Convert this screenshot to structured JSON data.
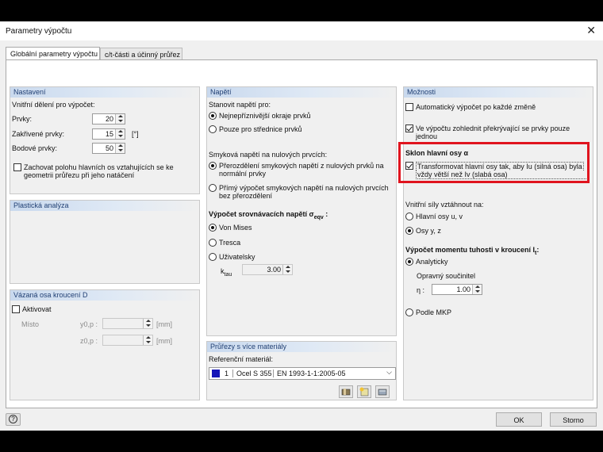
{
  "window": {
    "title": "Parametry výpočtu",
    "close": "✕"
  },
  "tabs": [
    "Globální parametry výpočtu",
    "c/t-části a účinný průřez"
  ],
  "nastaveni": {
    "title": "Nastavení",
    "division_label": "Vnitřní dělení pro výpočet:",
    "prvky_label": "Prvky:",
    "prvky_value": "20",
    "zakrivene_label": "Zakřivené prvky:",
    "zakrivene_value": "15",
    "zakrivene_unit": "[°]",
    "bodove_label": "Bodové prvky:",
    "bodove_value": "50",
    "keep_label_1": "Zachovat polohu hlavních os vztahujících se ke",
    "keep_label_2": "geometrii průřezu při jeho natáčení"
  },
  "plasticka": {
    "title": "Plastická analýza"
  },
  "vazana": {
    "title": "Vázaná osa kroucení D",
    "activate": "Aktivovat",
    "misto": "Místo",
    "y_label": "y0,p :",
    "z_label": "z0,p :",
    "unit": "[mm]"
  },
  "napeti": {
    "title": "Napětí",
    "stanovit": "Stanovit napětí pro:",
    "opt1": "Nejnepříznivější okraje prvků",
    "opt2": "Pouze pro střednice prvků",
    "smykova": "Smyková napětí na nulových prvcích:",
    "sm1a": "Přerozdělení smykových napětí z nulových prvků na",
    "sm1b": "normální prvky",
    "sm2a": "Přímý výpočet smykových napětí na nulových prvcích",
    "sm2b": "bez přerozdělení",
    "srovn": "Výpočet srovnávacích napětí σ",
    "srovn_sub": "eqv",
    "srovn_end": ":",
    "vonmises": "Von Mises",
    "tresca": "Tresca",
    "uzivatelsky": "Uživatelsky",
    "ktau": "k",
    "ktau_sub": "tau",
    "ktau_value": "3.00"
  },
  "pruzezy": {
    "title": "Průřezy s více materiály",
    "ref": "Referenční materiál:",
    "sel_num": "1",
    "sel_mat": "Ocel S 355",
    "sel_norm": "EN 1993-1-1:2005-05",
    "swatch_color": "#1515b8"
  },
  "moznosti": {
    "title": "Možnosti",
    "auto": "Automatický výpočet po každé změně",
    "overlap_1": "Ve výpočtu zohlednit překrývající se prvky pouze",
    "overlap_2": "jednou",
    "sklon": "Sklon hlavní osy α",
    "transform_1": "Transformovat hlavní osy tak, aby Iu (silná osa) byla",
    "transform_2": "vždy větší než Iv (slabá  osa)",
    "vnitrni": "Vnitřní síly vztáhnout na:",
    "hlavni": "Hlavní osy u, v",
    "osyyz": "Osy y, z",
    "moment": "Výpočet momentu tuhosti v kroucení I",
    "moment_sub": "t",
    "moment_end": ":",
    "analyticky": "Analyticky",
    "opravny": "Opravný součinitel",
    "eta": "η :",
    "eta_value": "1.00",
    "mkp": "Podle MKP"
  },
  "footer": {
    "help": "?",
    "ok": "OK",
    "cancel": "Storno"
  },
  "colors": {
    "highlight": "#e0141e",
    "panel_header_text": "#203f73"
  }
}
